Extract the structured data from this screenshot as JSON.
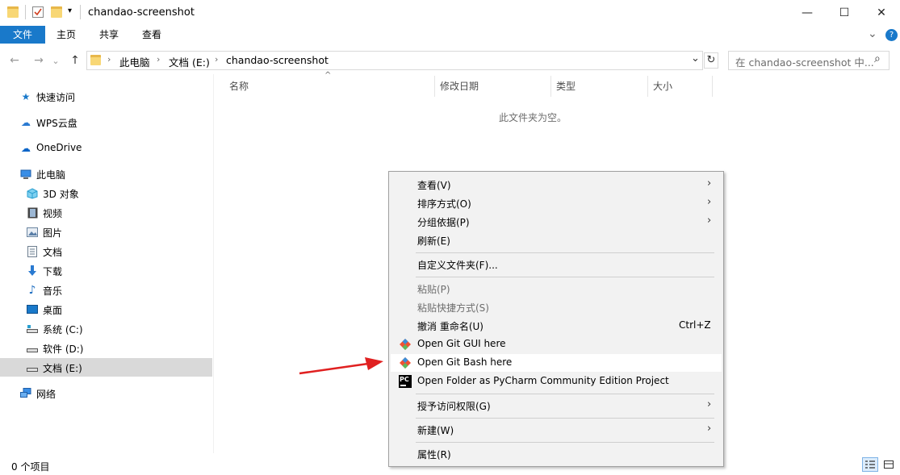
{
  "window": {
    "title": "chandao-screenshot",
    "min_glyph": "—",
    "max_glyph": "☐",
    "close_glyph": "✕"
  },
  "ribbon": {
    "tabs": [
      "文件",
      "主页",
      "共享",
      "查看"
    ],
    "expand_glyph": "⌄",
    "help_glyph": "?"
  },
  "address": {
    "back_glyph": "←",
    "forward_glyph": "→",
    "recent_glyph": "⌄",
    "up_glyph": "↑",
    "crumbs": [
      "此电脑",
      "文档 (E:)",
      "chandao-screenshot"
    ],
    "sep_glyph": "›",
    "dropdown_glyph": "⌄",
    "refresh_glyph": "↻"
  },
  "search": {
    "placeholder": "在 chandao-screenshot 中...",
    "icon_glyph": "⌕"
  },
  "nav": {
    "items": [
      {
        "label": "快速访问",
        "icon": "star-icon",
        "glyph": "★",
        "color": "#1979ca"
      },
      {
        "label": "WPS云盘",
        "icon": "cloud-icon",
        "glyph": "☁",
        "color": "#2a7ad1"
      },
      {
        "label": "OneDrive",
        "icon": "onedrive-icon",
        "glyph": "☁",
        "color": "#0a64c8"
      },
      {
        "label": "此电脑",
        "icon": "computer-icon",
        "glyph": "🖳",
        "color": "#3a8ee6"
      },
      {
        "label": "3D 对象",
        "icon": "cube-icon",
        "glyph": "▣",
        "color": "#3ab0e0"
      },
      {
        "label": "视频",
        "icon": "video-icon",
        "glyph": "▤",
        "color": "#444444"
      },
      {
        "label": "图片",
        "icon": "pictures-icon",
        "glyph": "▨",
        "color": "#5a7fa8"
      },
      {
        "label": "文档",
        "icon": "documents-icon",
        "glyph": "▯",
        "color": "#607080"
      },
      {
        "label": "下载",
        "icon": "download-icon",
        "glyph": "⬇",
        "color": "#2a7ad1"
      },
      {
        "label": "音乐",
        "icon": "music-icon",
        "glyph": "♪",
        "color": "#1a6cc0"
      },
      {
        "label": "桌面",
        "icon": "desktop-icon",
        "glyph": "▭",
        "color": "#1979ca"
      },
      {
        "label": "系统 (C:)",
        "icon": "drive-c-icon",
        "glyph": "▬",
        "color": "#555555"
      },
      {
        "label": "软件 (D:)",
        "icon": "drive-d-icon",
        "glyph": "▬",
        "color": "#555555"
      },
      {
        "label": "文档 (E:)",
        "icon": "drive-e-icon",
        "glyph": "▬",
        "color": "#555555"
      },
      {
        "label": "网络",
        "icon": "network-icon",
        "glyph": "🖧",
        "color": "#2a7ad1"
      }
    ]
  },
  "columns": {
    "name": "名称",
    "modified": "修改日期",
    "type": "类型",
    "size": "大小",
    "sort_glyph": "^"
  },
  "content": {
    "empty_message": "此文件夹为空。"
  },
  "status": {
    "item_count": "0 个项目"
  },
  "context_menu": {
    "items": [
      {
        "label": "查看(V)",
        "arrow": "›"
      },
      {
        "label": "排序方式(O)",
        "arrow": "›"
      },
      {
        "label": "分组依据(P)",
        "arrow": "›"
      },
      {
        "label": "刷新(E)"
      },
      {
        "label": "自定义文件夹(F)..."
      },
      {
        "label": "粘贴(P)"
      },
      {
        "label": "粘贴快捷方式(S)"
      },
      {
        "label": "撤消 重命名(U)",
        "shortcut": "Ctrl+Z"
      },
      {
        "label": "Open Git GUI here"
      },
      {
        "label": "Open Git Bash here"
      },
      {
        "label": "Open Folder as PyCharm Community Edition Project"
      },
      {
        "label": "授予访问权限(G)",
        "arrow": "›"
      },
      {
        "label": "新建(W)",
        "arrow": "›"
      },
      {
        "label": "属性(R)"
      }
    ],
    "pycharm_icon_text": "PC"
  },
  "colors": {
    "accent": "#1979ca",
    "arrow_red": "#e02020",
    "highlight": "#ffffff",
    "menu_bg": "#f2f2f2"
  }
}
